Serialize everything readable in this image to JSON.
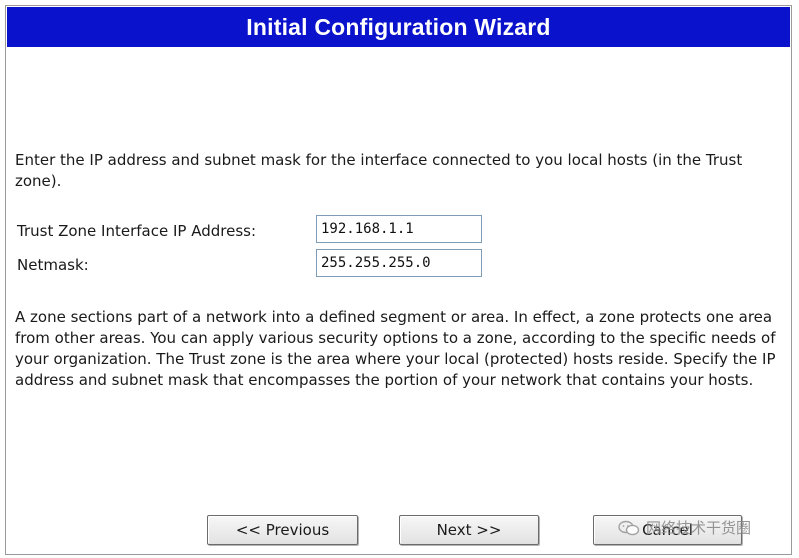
{
  "header": {
    "title": "Initial Configuration Wizard"
  },
  "intro_text": "Enter the IP address and subnet mask for the interface connected to you local hosts (in the Trust zone).",
  "form": {
    "ip_label": "Trust Zone Interface IP Address:",
    "ip_value": "192.168.1.1",
    "netmask_label": "Netmask:",
    "netmask_value": "255.255.255.0"
  },
  "help_text": "A zone sections part of a network into a defined segment or area. In effect, a zone protects one area from other areas. You can apply various security options to a zone, according to the specific needs of your organization. The Trust zone is the area where your local (protected) hosts reside. Specify the IP address and subnet mask that encompasses the portion of your network that contains your hosts.",
  "buttons": {
    "previous": "<< Previous",
    "next": "Next >>",
    "cancel": "Cancel"
  },
  "watermark": {
    "text": "网络技术干货圈",
    "icon": "wechat-icon"
  },
  "colors": {
    "title_bar": "#0a12cc",
    "title_text": "#ffffff",
    "input_border": "#7f9db9"
  }
}
